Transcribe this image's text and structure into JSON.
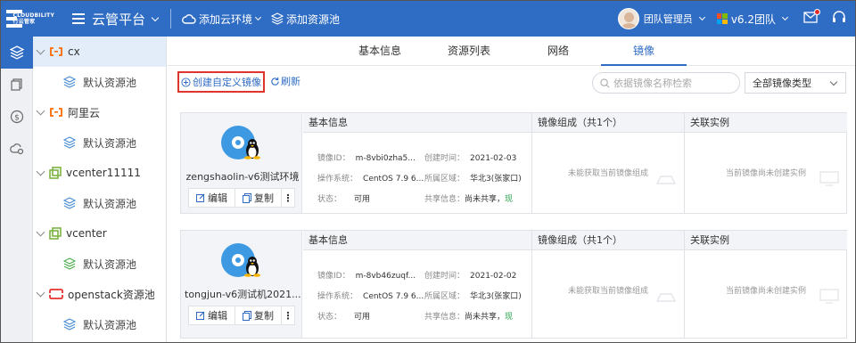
{
  "brand": {
    "line1": "CLOUDBILITY",
    "line2": "行云管家"
  },
  "header": {
    "platform": "云管平台",
    "add_cloud": "添加云环境",
    "add_pool": "添加资源池",
    "user": "团队管理员",
    "team": "v6.2团队"
  },
  "tree": [
    {
      "label": "cx",
      "type": "cloud-parent"
    },
    {
      "label": "默认资源池",
      "type": "pool"
    },
    {
      "label": "阿里云",
      "type": "cloud-parent"
    },
    {
      "label": "默认资源池",
      "type": "pool"
    },
    {
      "label": "vcenter11111",
      "type": "vcenter-parent"
    },
    {
      "label": "默认资源池",
      "type": "pool"
    },
    {
      "label": "vcenter",
      "type": "vcenter-parent"
    },
    {
      "label": "默认资源池",
      "type": "pool"
    },
    {
      "label": "openstack资源池",
      "type": "openstack-parent"
    },
    {
      "label": "默认资源池",
      "type": "pool"
    }
  ],
  "tabs": [
    "基本信息",
    "资源列表",
    "网络",
    "镜像"
  ],
  "active_tab": "镜像",
  "toolbar": {
    "create": "创建自定义镜像",
    "refresh": "刷新",
    "search_placeholder": "依据镜像名称检索",
    "type_select": "全部镜像类型"
  },
  "columns": {
    "basic": "基本信息",
    "composition": "镜像组成（共1个）",
    "related": "关联实例"
  },
  "labels": {
    "id": "镜像ID",
    "os": "操作系统",
    "status": "状态",
    "created": "创建时间",
    "region": "所属区域",
    "share": "共享信息"
  },
  "actions": {
    "edit": "编辑",
    "copy": "复制",
    "more": "⋮"
  },
  "images": [
    {
      "name": "zengshaolin-v6测试环境",
      "id": "m-8vbi0zha5...",
      "os": "CentOS 7.9 6...",
      "status": "可用",
      "created": "2021-02-03",
      "region": "华北3(张家口)",
      "share_prefix": "尚未共享，",
      "share_link": "现",
      "composition_empty": "未能获取当前镜像组成",
      "related_empty": "当前镜像尚未创建实例"
    },
    {
      "name": "tongjun-v6测试机2021...",
      "id": "m-8vb46zuqf...",
      "os": "CentOS 7.9 6...",
      "status": "可用",
      "created": "2021-02-02",
      "region": "华北3(张家口)",
      "share_prefix": "尚未共享，",
      "share_link": "现",
      "composition_empty": "未能获取当前镜像组成",
      "related_empty": "当前镜像尚未创建实例"
    }
  ],
  "colors": {
    "brand": "#2f6cc4",
    "highlight": "#e0342f",
    "ok": "#2ea44f"
  }
}
